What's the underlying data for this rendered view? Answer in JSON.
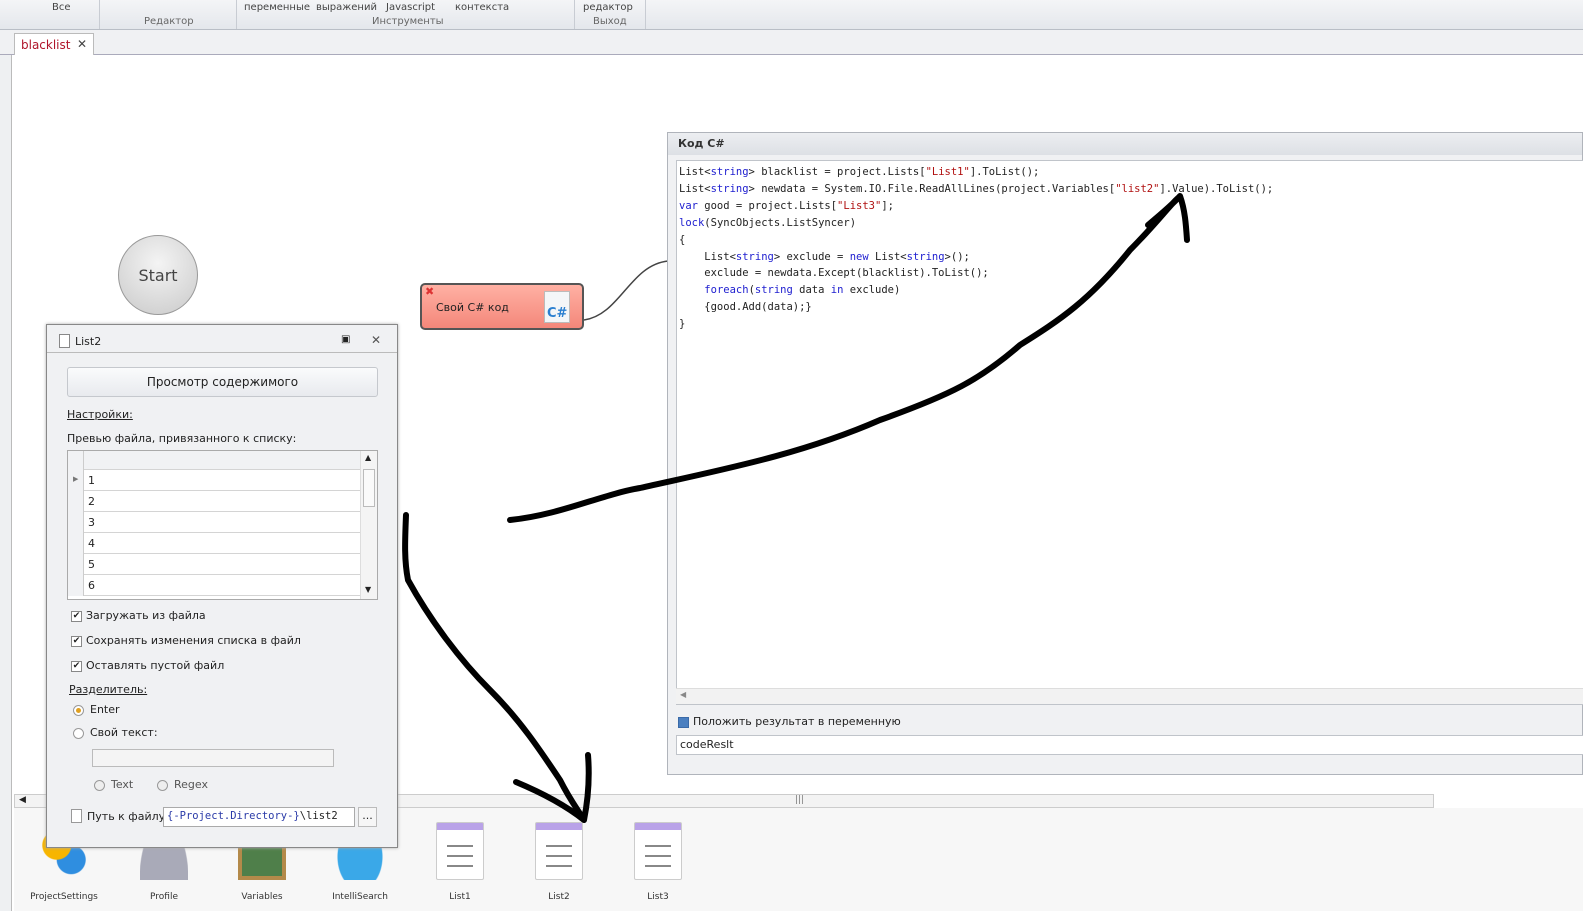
{
  "ribbon": {
    "items": [
      "Все",
      "переменные",
      "выражений",
      "Javascript",
      "контекста",
      "редактор"
    ],
    "groups": [
      "Редактор",
      "Инструменты",
      "Выход"
    ]
  },
  "tab": {
    "label": "blacklist",
    "close": "✕"
  },
  "canvas": {
    "start_label": "Start",
    "node_label": "Свой C# код"
  },
  "code_panel": {
    "title": "Код C#",
    "lines": [
      [
        [
          "List<",
          ""
        ],
        [
          "string",
          "kw"
        ],
        [
          "> blacklist = project.Lists[",
          ""
        ],
        [
          "\"List1\"",
          "str"
        ],
        [
          "].ToList();",
          ""
        ]
      ],
      [
        [
          "List<",
          ""
        ],
        [
          "string",
          "kw"
        ],
        [
          "> newdata = System.IO.File.ReadAllLines(project.Variables[",
          ""
        ],
        [
          "\"list2\"",
          "str"
        ],
        [
          "].Value).ToList();",
          ""
        ]
      ],
      [
        [
          "var",
          "kw"
        ],
        [
          " good = project.Lists[",
          ""
        ],
        [
          "\"List3\"",
          "str"
        ],
        [
          "];",
          ""
        ]
      ],
      [
        [
          "lock",
          "kw"
        ],
        [
          "(SyncObjects.ListSyncer)",
          ""
        ]
      ],
      [
        [
          "{",
          ""
        ]
      ],
      [
        [
          "    List<",
          ""
        ],
        [
          "string",
          "kw"
        ],
        [
          "> exclude = ",
          ""
        ],
        [
          "new",
          "kw"
        ],
        [
          " List<",
          ""
        ],
        [
          "string",
          "kw"
        ],
        [
          ">();",
          ""
        ]
      ],
      [
        [
          "    exclude = newdata.Except(blacklist).ToList();",
          ""
        ]
      ],
      [
        [
          "    ",
          ""
        ],
        [
          "foreach",
          "kw"
        ],
        [
          "(",
          ""
        ],
        [
          "string",
          "kw"
        ],
        [
          " data ",
          ""
        ],
        [
          "in",
          "kw"
        ],
        [
          " exclude)",
          ""
        ]
      ],
      [
        [
          "    {good.Add(data);}",
          ""
        ]
      ],
      [
        [
          "}",
          ""
        ]
      ]
    ],
    "result_checkbox_label": "Положить результат в переменную",
    "result_checked": false,
    "result_variable": "codeReslt"
  },
  "list_panel": {
    "title": "List2",
    "preview_button": "Просмотр содержимого",
    "settings_link": "Настройки:",
    "preview_label": "Превью файла, привязанного к списку:",
    "rows": [
      "1",
      "2",
      "3",
      "4",
      "5",
      "6"
    ],
    "checkboxes": [
      {
        "label": "Загружать из файла",
        "checked": true
      },
      {
        "label": "Сохранять изменения списка в файл",
        "checked": true
      },
      {
        "label": "Оставлять пустой файл",
        "checked": true
      }
    ],
    "separator_label": "Разделитель:",
    "sep_enter": "Enter",
    "sep_custom": "Свой текст:",
    "sep_selected": "Enter",
    "mode_text": "Text",
    "mode_regex": "Regex",
    "path_label": "Путь к файлу",
    "path_var": "{-Project.Directory-}",
    "path_rest": "\\list2",
    "browse": "..."
  },
  "bottom_items": [
    "ProjectSettings",
    "Profile",
    "Variables",
    "IntelliSearch",
    "List1",
    "List2",
    "List3"
  ],
  "colors": {
    "node": "#f4877a",
    "accent_tab": "#b0142a"
  }
}
